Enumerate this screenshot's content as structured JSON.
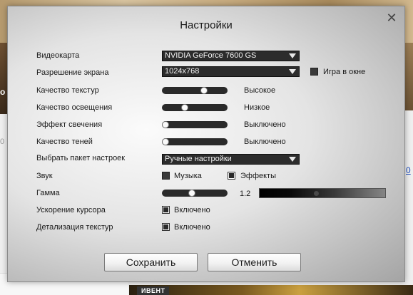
{
  "background": {
    "left_letter": "о",
    "side_text": "0",
    "side_link": "0",
    "bottom_badge": "ИВЕНТ"
  },
  "dialog": {
    "title": "Настройки",
    "close_symbol": "✕",
    "rows": {
      "videocard": {
        "label": "Видеокарта",
        "value": "NVIDIA GeForce 7600 GS"
      },
      "resolution": {
        "label": "Разрешение экрана",
        "value": "1024x768"
      },
      "windowed": {
        "label": "Игра в окне",
        "checked": false
      },
      "texture_quality": {
        "label": "Качество текстур",
        "value_text": "Высокое",
        "level": 0.66
      },
      "lighting_quality": {
        "label": "Качество освещения",
        "value_text": "Низкое",
        "level": 0.33
      },
      "glow_effect": {
        "label": "Эффект свечения",
        "value_text": "Выключено",
        "level": 0
      },
      "shadow_quality": {
        "label": "Качество теней",
        "value_text": "Выключено",
        "level": 0
      },
      "preset": {
        "label": "Выбрать пакет настроек",
        "value": "Ручные настройки"
      },
      "sound": {
        "label": "Звук",
        "music_label": "Музыка",
        "music_checked": true,
        "effects_label": "Эффекты",
        "effects_checked": true
      },
      "gamma": {
        "label": "Гамма",
        "value_text": "1.2",
        "level": 0.45
      },
      "cursor_accel": {
        "label": "Ускорение курсора",
        "option_label": "Включено",
        "checked": true
      },
      "texture_detail": {
        "label": "Детализация текстур",
        "option_label": "Включено",
        "checked": true
      }
    },
    "buttons": {
      "save": "Сохранить",
      "cancel": "Отменить"
    }
  }
}
